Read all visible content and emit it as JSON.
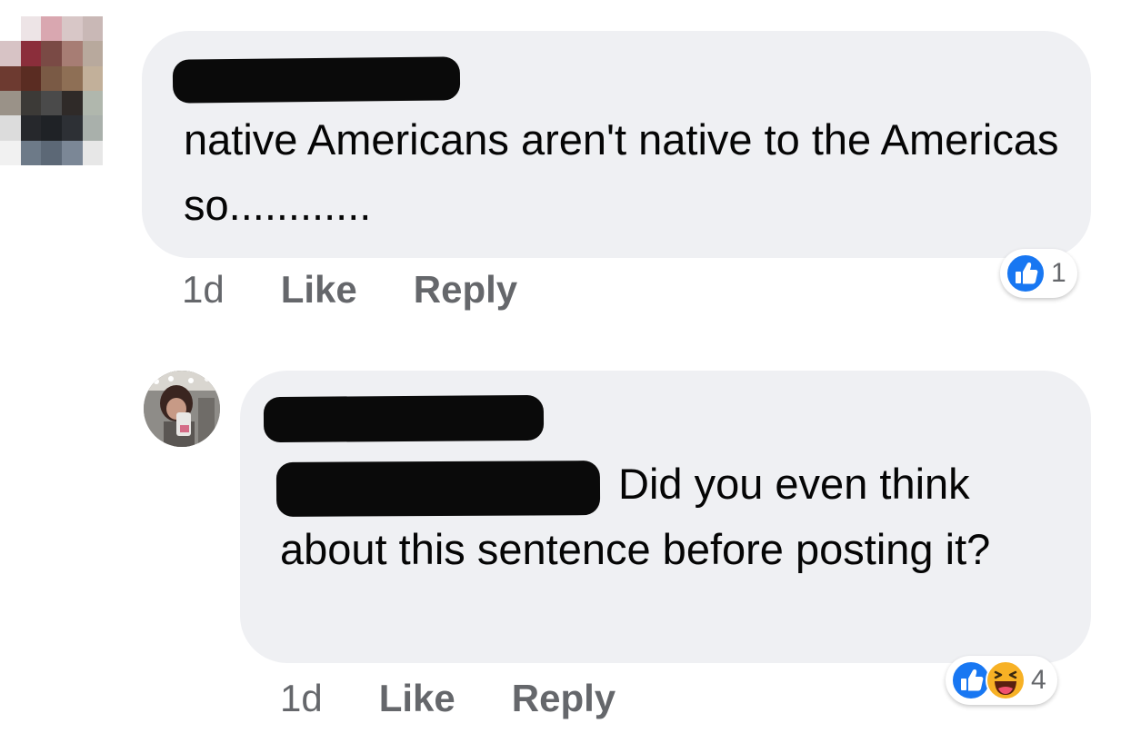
{
  "comments": [
    {
      "text": "native Americans aren't native to the Americas so............",
      "time": "1d",
      "like_label": "Like",
      "reply_label": "Reply",
      "reactions": [
        "like-icon"
      ],
      "reaction_count": "1"
    },
    {
      "text_first_line": "Did you even think",
      "text_rest": "about this sentence before posting it?",
      "time": "1d",
      "like_label": "Like",
      "reply_label": "Reply",
      "reactions": [
        "like-icon",
        "haha-icon"
      ],
      "reaction_count": "4"
    }
  ],
  "colors": {
    "bubble": "#eff0f3",
    "meta_text": "#65676b",
    "like_blue": "#1877f2",
    "haha_yellow": "#f7b125",
    "redaction": "#0a0a0a"
  }
}
